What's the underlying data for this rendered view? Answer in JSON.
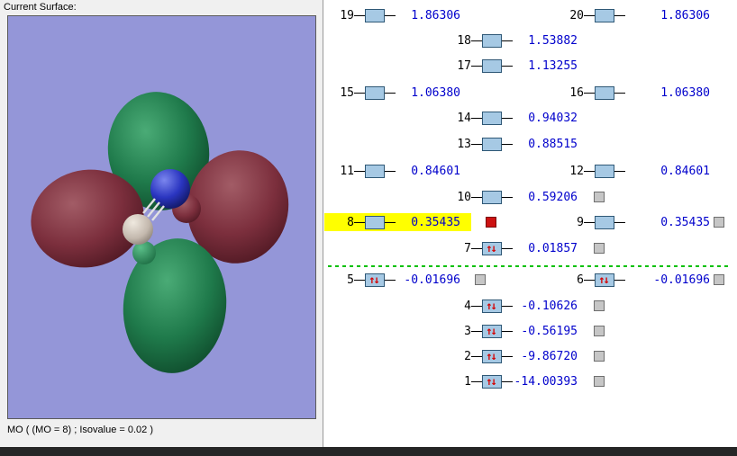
{
  "left_panel": {
    "title": "Current Surface:",
    "status": "MO ( (MO = 8) ; Isovalue = 0.02 )"
  },
  "icons": {
    "electron_pair": "↑↓"
  },
  "colors": {
    "energy_text": "#0000cc",
    "highlight": "#ffff00",
    "selected_marker": "#cc1111",
    "zero_line": "#00c000",
    "viewport_background": "#9496d8",
    "orbital_box": "#a6c9e4",
    "lobe_green": "#1f7a4b",
    "lobe_red": "#7c2f3d"
  },
  "orbitals": {
    "o20": {
      "num": "20",
      "energy": "1.86306"
    },
    "o19": {
      "num": "19",
      "energy": "1.86306"
    },
    "o18": {
      "num": "18",
      "energy": "1.53882"
    },
    "o17": {
      "num": "17",
      "energy": "1.13255"
    },
    "o16": {
      "num": "16",
      "energy": "1.06380"
    },
    "o15": {
      "num": "15",
      "energy": "1.06380"
    },
    "o14": {
      "num": "14",
      "energy": "0.94032"
    },
    "o13": {
      "num": "13",
      "energy": "0.88515"
    },
    "o12": {
      "num": "12",
      "energy": "0.84601"
    },
    "o11": {
      "num": "11",
      "energy": "0.84601"
    },
    "o10": {
      "num": "10",
      "energy": "0.59206"
    },
    "o9": {
      "num": "9",
      "energy": "0.35435"
    },
    "o8": {
      "num": "8",
      "energy": "0.35435"
    },
    "o7": {
      "num": "7",
      "energy": "0.01857"
    },
    "o6": {
      "num": "6",
      "energy": "-0.01696"
    },
    "o5": {
      "num": "5",
      "energy": "-0.01696"
    },
    "o4": {
      "num": "4",
      "energy": "-0.10626"
    },
    "o3": {
      "num": "3",
      "energy": "-0.56195"
    },
    "o2": {
      "num": "2",
      "energy": "-9.86720"
    },
    "o1": {
      "num": "1",
      "energy": "-14.00393"
    }
  }
}
